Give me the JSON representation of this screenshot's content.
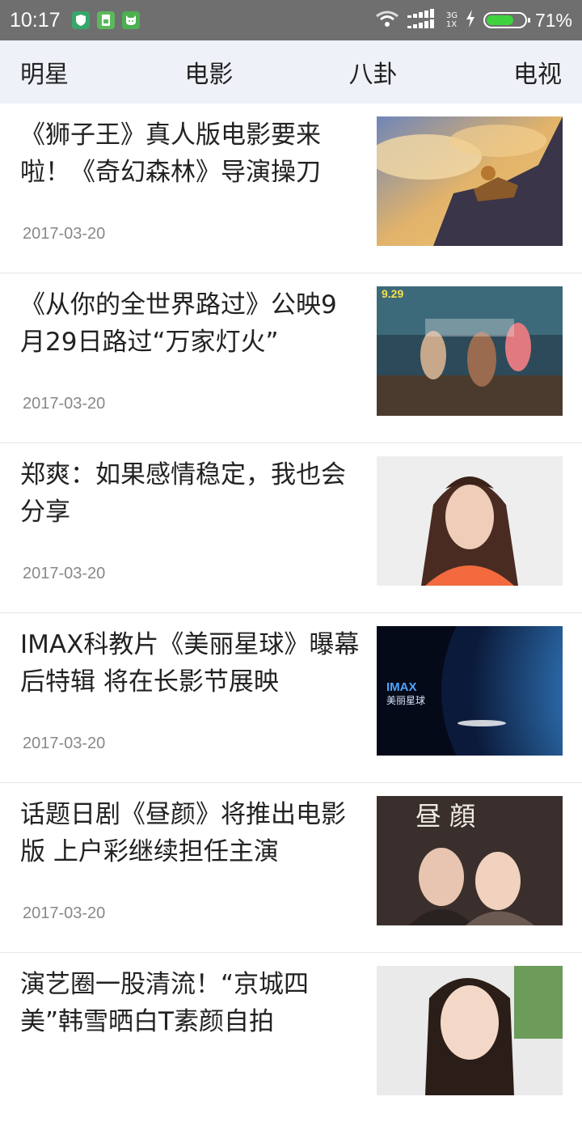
{
  "status_bar": {
    "time": "10:17",
    "network_top": "3G",
    "network_bottom": "1X",
    "battery_percent": "71%",
    "battery_level": 0.71
  },
  "tabs": [
    {
      "label": "明星"
    },
    {
      "label": "电影"
    },
    {
      "label": "八卦"
    },
    {
      "label": "电视"
    }
  ],
  "articles": [
    {
      "title": "《狮子王》真人版电影要来啦！《奇幻森林》导演操刀",
      "date": "2017-03-20",
      "thumb": "lion-king"
    },
    {
      "title": "《从你的全世界路过》公映9月29日路过“万家灯火”",
      "date": "2017-03-20",
      "thumb": "movie-poster"
    },
    {
      "title": "郑爽：如果感情稳定，我也会分享",
      "date": "2017-03-20",
      "thumb": "portrait-woman"
    },
    {
      "title": "IMAX科教片《美丽星球》曝幕后特辑 将在长影节展映",
      "date": "2017-03-20",
      "thumb": "earth-poster"
    },
    {
      "title": "话题日剧《昼颜》将推出电影版 上户彩继续担任主演",
      "date": "2017-03-20",
      "thumb": "drama-poster"
    },
    {
      "title": "演艺圈一股清流！“京城四美”韩雪晒白T素颜自拍",
      "date": "",
      "thumb": "selfie-woman"
    }
  ],
  "poster_texts": {
    "imax": "IMAX",
    "imax_sub": "美丽星球",
    "drama": "昼 顔",
    "date_tag": "9.29"
  }
}
